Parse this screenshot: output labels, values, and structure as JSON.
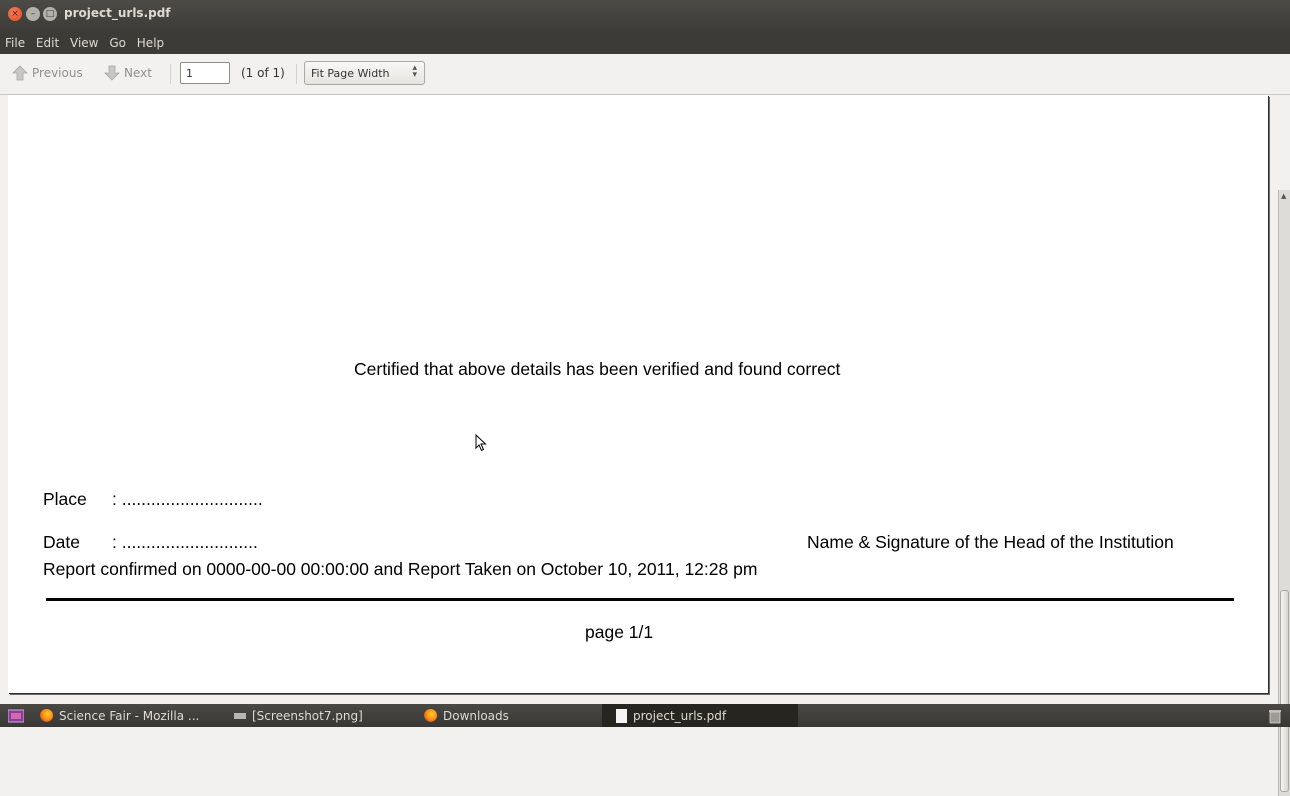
{
  "window": {
    "title": "project_urls.pdf"
  },
  "menu": [
    "File",
    "Edit",
    "View",
    "Go",
    "Help"
  ],
  "toolbar": {
    "previous_label": "Previous",
    "next_label": "Next",
    "page_value": "1",
    "page_count": "(1 of 1)",
    "zoom_value": "Fit Page Width"
  },
  "document": {
    "certified_text": "Certified that above details has been verified and found correct",
    "place_label": "Place",
    "place_value": ": .............................",
    "date_label": "Date",
    "date_value": ": ............................",
    "signature_label": "Name & Signature of the Head of the Institution",
    "report_line": "Report confirmed on 0000-00-00 00:00:00 and Report Taken on October 10, 2011, 12:28 pm",
    "page_footer": "page 1/1"
  },
  "taskbar": {
    "items": [
      {
        "label": "Science Fair - Mozilla ...",
        "icon": "firefox-icon"
      },
      {
        "label": "[Screenshot7.png]",
        "icon": "image-window-icon"
      },
      {
        "label": "Downloads",
        "icon": "firefox-icon"
      },
      {
        "label": "project_urls.pdf",
        "icon": "document-icon",
        "active": true
      }
    ]
  }
}
